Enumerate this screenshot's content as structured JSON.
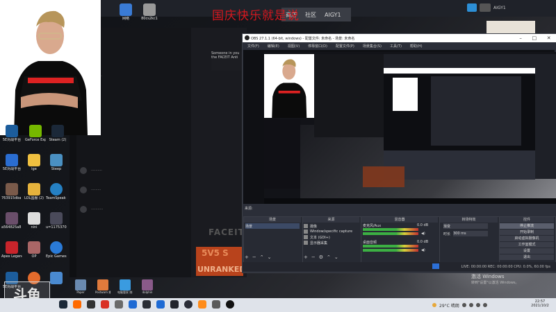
{
  "banner": "国庆快乐就是说",
  "topbar": {
    "nav_items": [
      "商店",
      "社区",
      "AIGY1"
    ],
    "right_label": "AIGY1"
  },
  "desktop_icons": [
    {
      "label": "网络"
    },
    {
      "label": "80cs2kc1"
    },
    {
      "label": "5E对战平台"
    },
    {
      "label": "GeForce Experience"
    },
    {
      "label": "Steam (2)"
    },
    {
      "label": "5E对战平台"
    },
    {
      "label": "lge"
    },
    {
      "label": "Steep"
    },
    {
      "label": "763915dba 9e4c8ad8..."
    },
    {
      "label": "LOL国服 (2)"
    },
    {
      "label": "TeamSpeak 3"
    },
    {
      "label": "a564825a8 4565433..."
    },
    {
      "label": "nini"
    },
    {
      "label": "u=1175370 0314,2022..."
    },
    {
      "label": "Apex Legends"
    },
    {
      "label": "OP"
    },
    {
      "label": "Epic Games Launcher"
    },
    {
      "label": "5E对战平台"
    },
    {
      "label": ""
    },
    {
      "label": ""
    }
  ],
  "faceit": {
    "box_line1": "Someone in you",
    "box_line2": "the FACEIT Anti",
    "logo": "FACEIT",
    "unranked_top": "5V5 S",
    "unranked_bottom": "UNRANKED"
  },
  "obs": {
    "title": "OBS 27.1.1 (64-bit, windows) - 配置文件: 未命名 - 场景: 未命名",
    "win_buttons": [
      "–",
      "□",
      "✕"
    ],
    "menu": [
      "文件(F)",
      "编辑(E)",
      "视图(V)",
      "停靠窗口(D)",
      "配置文件(P)",
      "场景集合(S)",
      "工具(T)",
      "帮助(H)"
    ],
    "dock_scenes_label": "来源:",
    "docks": {
      "scenes_header": "场景",
      "sources_header": "来源",
      "mixer_header": "混音器",
      "transitions_header": "转场特效",
      "controls_header": "控件"
    },
    "scenes": [
      "场景"
    ],
    "sources": [
      "摄像",
      "Window/specific capture",
      "文本 (GDI+)",
      "显示器采集"
    ],
    "mixer": [
      {
        "name": "麦克风/Aux",
        "level": "0.0 dB"
      },
      {
        "name": "桌面音频",
        "level": "0.0 dB"
      }
    ],
    "transition": {
      "mode": "渐变",
      "duration_label": "时长",
      "duration": "300 ms"
    },
    "controls": [
      "停止推流",
      "开始录制",
      "启动虚拟摄像机",
      "工作室模式",
      "设置",
      "退出"
    ],
    "status": "LIVE: 00:00:00   REC: 00:00:00   CPU: 0.0%, 60.00 fps"
  },
  "activate": {
    "line1": "激活 Windows",
    "line2": "转到\"设置\"以激活 Windows。"
  },
  "logo": "斗鱼",
  "taskbar_apps": [
    {
      "label": "Paper"
    },
    {
      "label": "Postwam 播放的..."
    },
    {
      "label": "电脑管家 挑平台"
    },
    {
      "label": "dolphin"
    }
  ],
  "tray": {
    "weather": "29°C 晴朗",
    "time": "22:57",
    "date": "2021/10/2"
  },
  "colors": {
    "banner": "#d4171e",
    "unranked": "#b8431c",
    "obs_bg": "#2b2e38",
    "accent": "#2c8fd6"
  }
}
